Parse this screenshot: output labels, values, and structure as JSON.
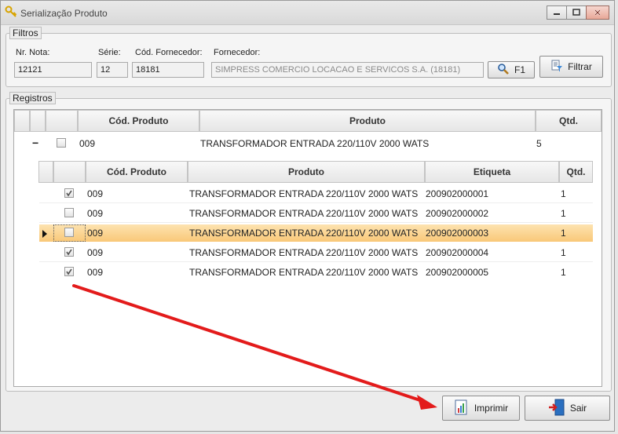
{
  "window": {
    "title": "Serialização Produto",
    "icon": "keys-icon",
    "controls": [
      "minimize",
      "maximize",
      "close"
    ]
  },
  "filtros": {
    "legend": "Filtros",
    "nr_nota": {
      "label": "Nr. Nota:",
      "value": "12121"
    },
    "serie": {
      "label": "Série:",
      "value": "12"
    },
    "cod_fornecedor": {
      "label": "Cód. Fornecedor:",
      "value": "18181"
    },
    "fornecedor": {
      "label": "Fornecedor:",
      "value": "SIMPRESS COMERCIO LOCACAO E SERVICOS S.A. (18181)"
    },
    "search_button": {
      "label": "F1",
      "icon": "magnifier-icon"
    },
    "filtrar_button": {
      "label": "Filtrar",
      "icon": "filter-icon"
    }
  },
  "registros": {
    "legend": "Registros",
    "columns": [
      "Cód. Produto",
      "Produto",
      "Qtd."
    ],
    "parent": {
      "expander": "−",
      "cod_produto": "009",
      "produto": "TRANSFORMADOR ENTRADA 220/110V 2000 WATS",
      "qtd": "5"
    },
    "child_columns": [
      "Cód. Produto",
      "Produto",
      "Etiqueta",
      "Qtd."
    ],
    "child_rows": [
      {
        "checked": true,
        "cod_produto": "009",
        "produto": "TRANSFORMADOR ENTRADA 220/110V 2000 WATS",
        "etiqueta": "200902000001",
        "qtd": "1"
      },
      {
        "checked": false,
        "cod_produto": "009",
        "produto": "TRANSFORMADOR ENTRADA 220/110V 2000 WATS",
        "etiqueta": "200902000002",
        "qtd": "1"
      },
      {
        "checked": false,
        "cod_produto": "009",
        "produto": "TRANSFORMADOR ENTRADA 220/110V 2000 WATS",
        "etiqueta": "200902000003",
        "qtd": "1",
        "selected": true
      },
      {
        "checked": true,
        "cod_produto": "009",
        "produto": "TRANSFORMADOR ENTRADA 220/110V 2000 WATS",
        "etiqueta": "200902000004",
        "qtd": "1"
      },
      {
        "checked": true,
        "cod_produto": "009",
        "produto": "TRANSFORMADOR ENTRADA 220/110V 2000 WATS",
        "etiqueta": "200902000005",
        "qtd": "1"
      }
    ]
  },
  "footer": {
    "imprimir_button": {
      "label": "Imprimir",
      "icon": "printer-report-icon"
    },
    "sair_button": {
      "label": "Sair",
      "icon": "exit-door-icon"
    }
  },
  "colors": {
    "selected_row": "#f9c878",
    "annotation_arrow": "#e31b1b"
  }
}
